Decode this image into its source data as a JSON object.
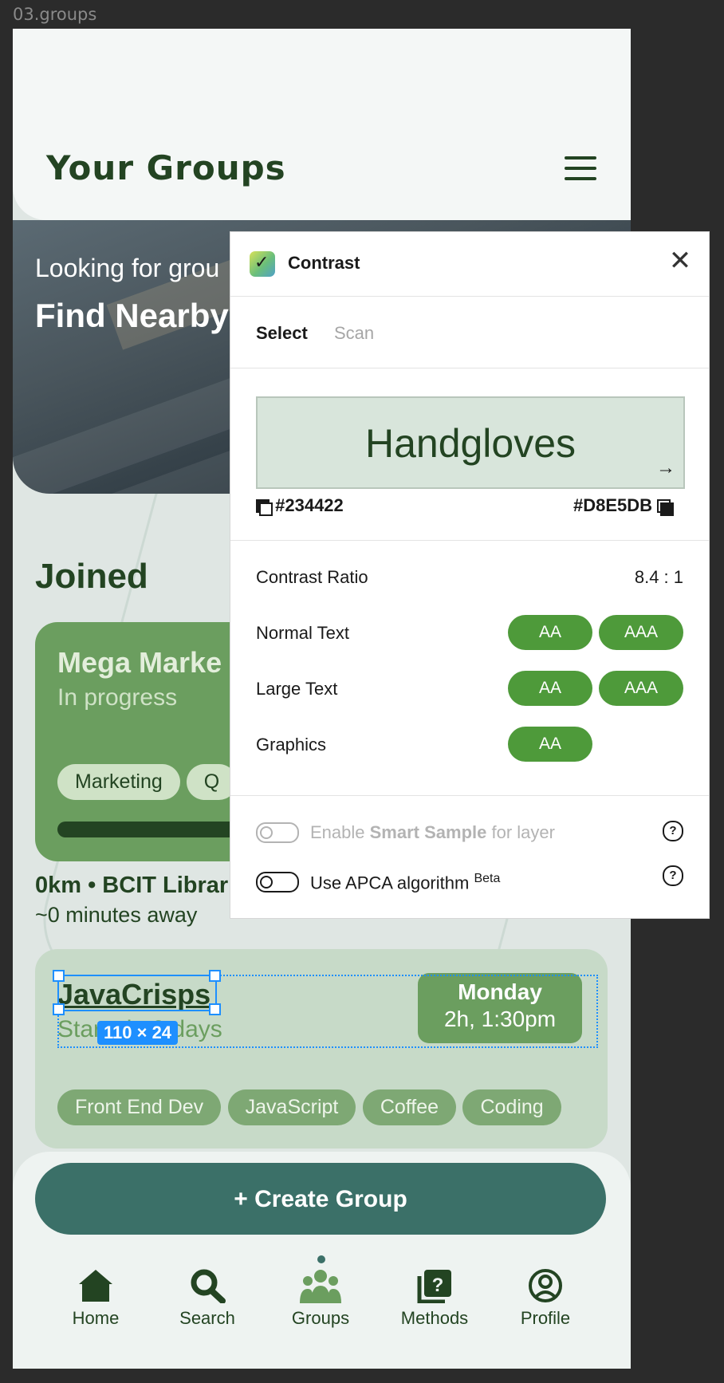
{
  "frame_label": "03.groups",
  "app": {
    "title": "Your Groups",
    "hero": {
      "subtitle": "Looking for grou",
      "heading": "Find Nearby"
    },
    "joined_heading": "Joined",
    "card1": {
      "name": "Mega Marke",
      "status": "In progress",
      "tags": [
        "Marketing",
        "Q"
      ],
      "progress": 1.0
    },
    "location": {
      "distance": "0km • BCIT Librar",
      "away": "~0 minutes away"
    },
    "card2": {
      "name": "JavaCrisps",
      "starts": "Starts in 0 days",
      "day": "Monday",
      "time": "2h, 1:30pm",
      "tags": [
        "Front End Dev",
        "JavaScript",
        "Coffee",
        "Coding"
      ]
    },
    "selection_size": "110 × 24",
    "create_button": "+ Create Group",
    "nav": [
      {
        "label": "Home",
        "icon": "home-icon"
      },
      {
        "label": "Search",
        "icon": "search-icon"
      },
      {
        "label": "Groups",
        "icon": "groups-icon",
        "active": true
      },
      {
        "label": "Methods",
        "icon": "methods-icon"
      },
      {
        "label": "Profile",
        "icon": "profile-icon"
      }
    ],
    "colors": {
      "primary_dark": "#234422",
      "accent_green": "#6b9e5f",
      "teal": "#3b7068"
    }
  },
  "contrast_panel": {
    "title": "Contrast",
    "close_glyph": "✕",
    "tabs": {
      "select": "Select",
      "scan": "Scan"
    },
    "sample_text": "Handgloves",
    "foreground": "#234422",
    "background": "#D8E5DB",
    "ratio_label": "Contrast Ratio",
    "ratio_value": "8.4 : 1",
    "rows": [
      {
        "label": "Normal Text",
        "badges": [
          "AA",
          "AAA"
        ]
      },
      {
        "label": "Large Text",
        "badges": [
          "AA",
          "AAA"
        ]
      },
      {
        "label": "Graphics",
        "badges": [
          "AA"
        ]
      }
    ],
    "smart_sample": {
      "pre": "Enable ",
      "bold": "Smart Sample",
      "post": " for layer"
    },
    "apca": {
      "label": "Use APCA algorithm ",
      "sup": "Beta"
    },
    "pass_color": "#4e9a3a"
  }
}
